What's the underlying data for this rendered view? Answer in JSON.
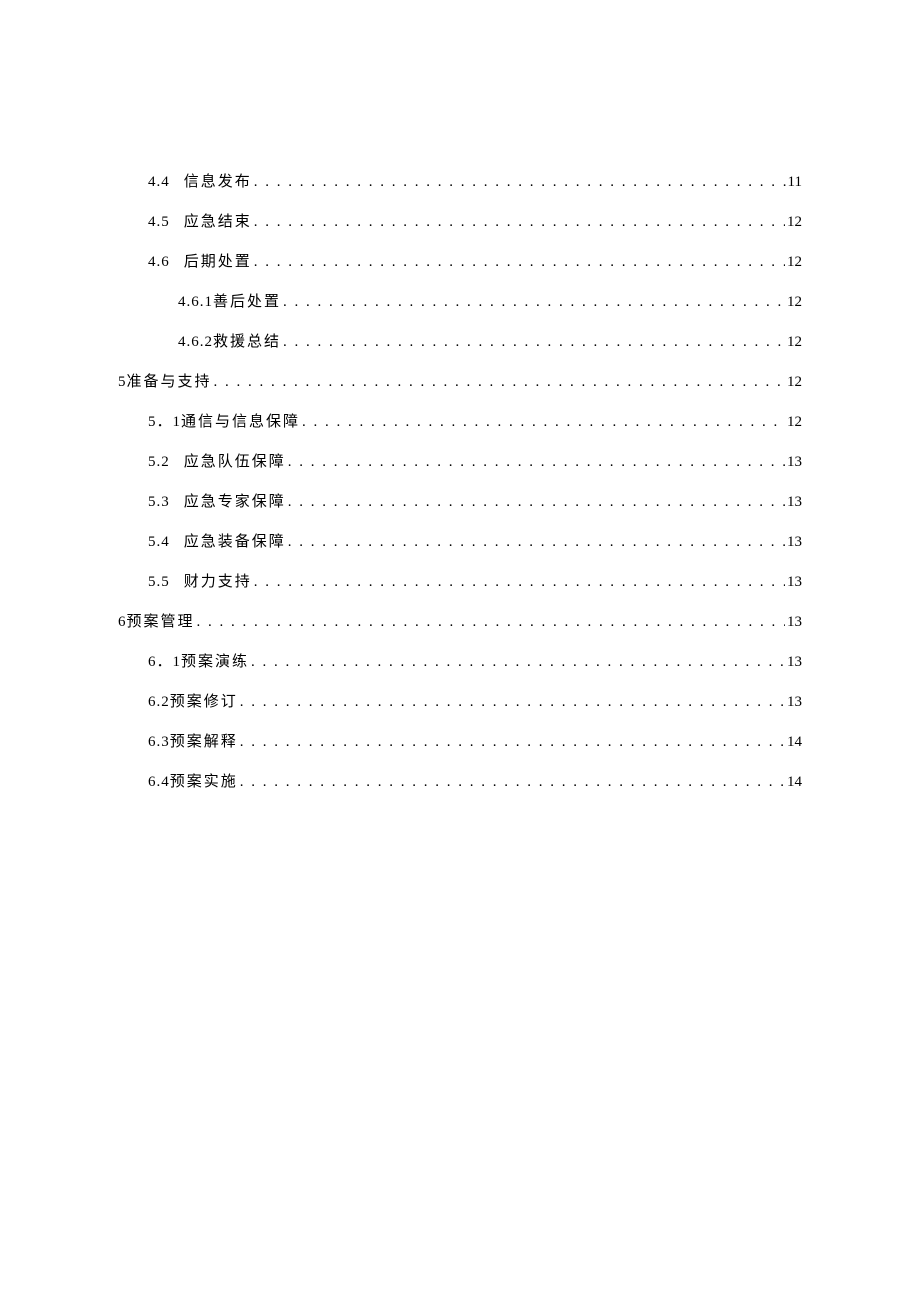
{
  "toc": [
    {
      "indent": 1,
      "num": "4.4",
      "gap": true,
      "title": "信息发布",
      "page": "11"
    },
    {
      "indent": 1,
      "num": "4.5",
      "gap": true,
      "title": "应急结束",
      "page": "12"
    },
    {
      "indent": 1,
      "num": "4.6",
      "gap": true,
      "title": "后期处置",
      "page": "12"
    },
    {
      "indent": 2,
      "num": "4.6.1",
      "gap": false,
      "title": "善后处置",
      "page": "12"
    },
    {
      "indent": 2,
      "num": "4.6.2",
      "gap": false,
      "title": "救援总结",
      "page": "12"
    },
    {
      "indent": 0,
      "num": "5",
      "gap": false,
      "title": "准备与支持",
      "page": "12"
    },
    {
      "indent": 1,
      "num": "5．1",
      "gap": false,
      "title": "通信与信息保障",
      "page": "12"
    },
    {
      "indent": 1,
      "num": "5.2",
      "gap": true,
      "title": "应急队伍保障",
      "page": "13"
    },
    {
      "indent": 1,
      "num": "5.3",
      "gap": true,
      "title": "应急专家保障",
      "page": "13"
    },
    {
      "indent": 1,
      "num": "5.4",
      "gap": true,
      "title": "应急装备保障",
      "page": "13"
    },
    {
      "indent": 1,
      "num": "5.5",
      "gap": true,
      "title": "财力支持",
      "page": "13"
    },
    {
      "indent": 0,
      "num": "6",
      "gap": false,
      "title": "预案管理",
      "page": "13"
    },
    {
      "indent": 1,
      "num": "6．1",
      "gap": false,
      "title": "预案演练",
      "page": "13"
    },
    {
      "indent": 1,
      "num": "6.2",
      "gap": false,
      "title": "预案修订",
      "page": "13"
    },
    {
      "indent": 1,
      "num": "6.3",
      "gap": false,
      "title": "预案解释",
      "page": "14"
    },
    {
      "indent": 1,
      "num": "6.4",
      "gap": false,
      "title": "预案实施",
      "page": "14"
    }
  ]
}
